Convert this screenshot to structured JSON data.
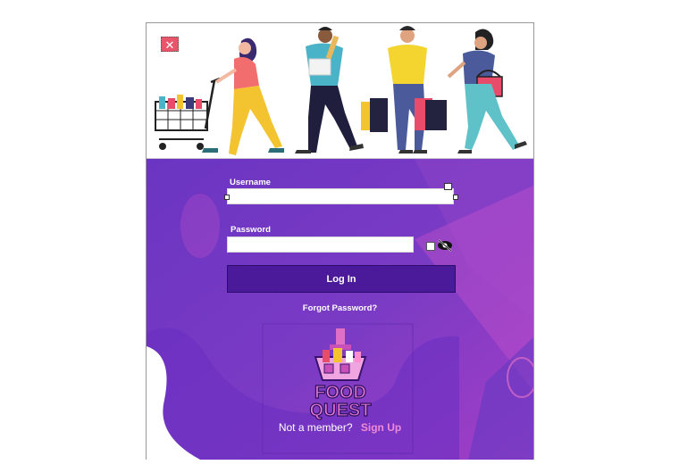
{
  "window": {
    "close_icon": "close-icon",
    "colors": {
      "accent": "#4b1a9b",
      "panel": "#7b3bc4",
      "signup": "#f08ad6",
      "close": "#e8566b"
    }
  },
  "banner": {
    "illustration": "shoppers-illustration"
  },
  "form": {
    "username_label": "Username",
    "username_value": "",
    "password_label": "Password",
    "password_value": "",
    "show_password_checked": false,
    "eye_icon": "eye-slash-icon",
    "login_label": "Log In",
    "forgot_label": "Forgot Password?"
  },
  "logo": {
    "text_line1": "FOOD",
    "text_line2": "QUEST"
  },
  "footer": {
    "prompt": "Not a member?",
    "signup_label": "Sign Up"
  }
}
